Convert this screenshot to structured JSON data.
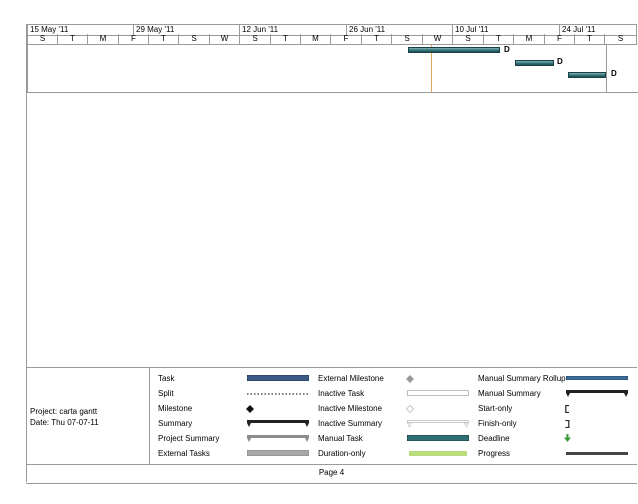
{
  "timescale": {
    "major": [
      "15 May '11",
      "29 May '11",
      "12 Jun '11",
      "26 Jun '11",
      "10 Jul '11",
      "24 Jul '11"
    ],
    "minor": [
      "S",
      "T",
      "M",
      "F",
      "T",
      "S",
      "W",
      "S",
      "T",
      "M",
      "F",
      "T",
      "S",
      "W",
      "S",
      "T",
      "M",
      "F",
      "T",
      "S"
    ]
  },
  "tasks": [
    {
      "label": "D"
    },
    {
      "label": "D"
    },
    {
      "label": "D"
    }
  ],
  "project": {
    "name": "Project: carta gantt",
    "date": "Date: Thu 07-07-11"
  },
  "legend": {
    "col1": [
      "Task",
      "Split",
      "Milestone",
      "Summary",
      "Project Summary",
      "External Tasks"
    ],
    "col2": [
      "External Milestone",
      "Inactive Task",
      "Inactive Milestone",
      "Inactive Summary",
      "Manual Task",
      "Duration-only"
    ],
    "col3": [
      "Manual Summary Rollup",
      "Manual Summary",
      "Start-only",
      "Finish-only",
      "Deadline",
      "Progress"
    ]
  },
  "colors": {
    "task": "#3b5b86",
    "manual_task": "#2f6e73",
    "deadline": "#3a9a3a",
    "duration_only": "#b9dc7c",
    "today_line": "#e8a35c"
  },
  "footer": {
    "page": "Page 4"
  }
}
